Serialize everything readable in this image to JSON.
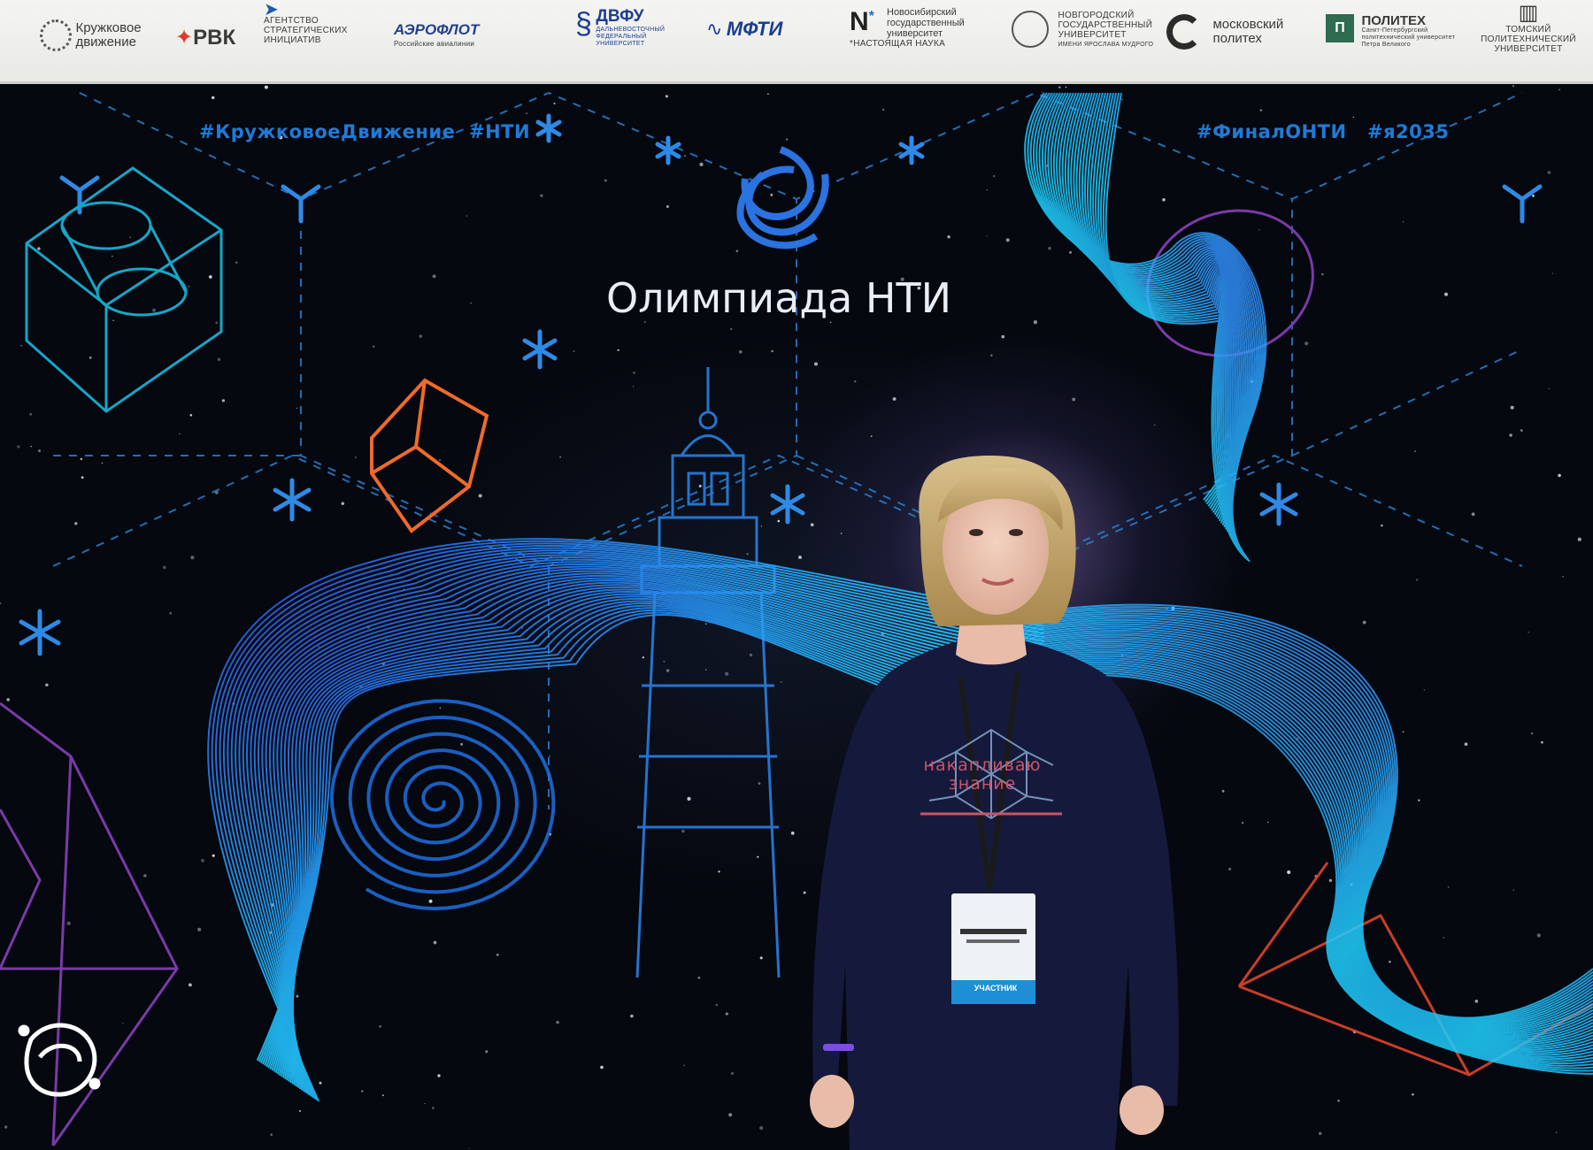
{
  "sponsors": {
    "kruzhkovoe": [
      "Кружковое",
      "движение"
    ],
    "rvk": "РВК",
    "asi": [
      "АГЕНТСТВО",
      "СТРАТЕГИЧЕСКИХ",
      "ИНИЦИАТИВ"
    ],
    "aeroflot": [
      "АЭРОФЛОТ",
      "Российские авиалинии"
    ],
    "dvfu": [
      "ДВФУ",
      "ДАЛЬНЕВОСТОЧНЫЙ",
      "ФЕДЕРАЛЬНЫЙ",
      "УНИВЕРСИТЕТ"
    ],
    "mfti": "МФТИ",
    "nsu": [
      "Новосибирский",
      "государственный",
      "университет",
      "*НАСТОЯЩАЯ НАУКА"
    ],
    "novgu": [
      "НОВГОРОДСКИЙ",
      "ГОСУДАРСТВЕННЫЙ",
      "УНИВЕРСИТЕТ",
      "ИМЕНИ ЯРОСЛАВА МУДРОГО"
    ],
    "mospolytech": [
      "московский",
      "политех"
    ],
    "spbpu": [
      "ПОЛИТЕХ",
      "Санкт-Петербургский",
      "политехнический университет",
      "Петра Великого"
    ],
    "tpu": [
      "ТОМСКИЙ",
      "ПОЛИТЕХНИЧЕСКИЙ",
      "УНИВЕРСИТЕТ"
    ]
  },
  "backdrop": {
    "hashtags_left": [
      "#КружковоеДвижение",
      "#НТИ"
    ],
    "hashtags_right": [
      "#ФиналОНТИ",
      "#я2035"
    ],
    "title": "Олимпиада НТИ"
  },
  "person": {
    "sweater_text": [
      "накапливаю",
      "знание"
    ],
    "badge_role": "УЧАСТНИК"
  },
  "colors": {
    "accent_blue": "#1f7bd6",
    "wave_cyan": "#1ea8ff",
    "sweater_navy": "#151a3c"
  }
}
